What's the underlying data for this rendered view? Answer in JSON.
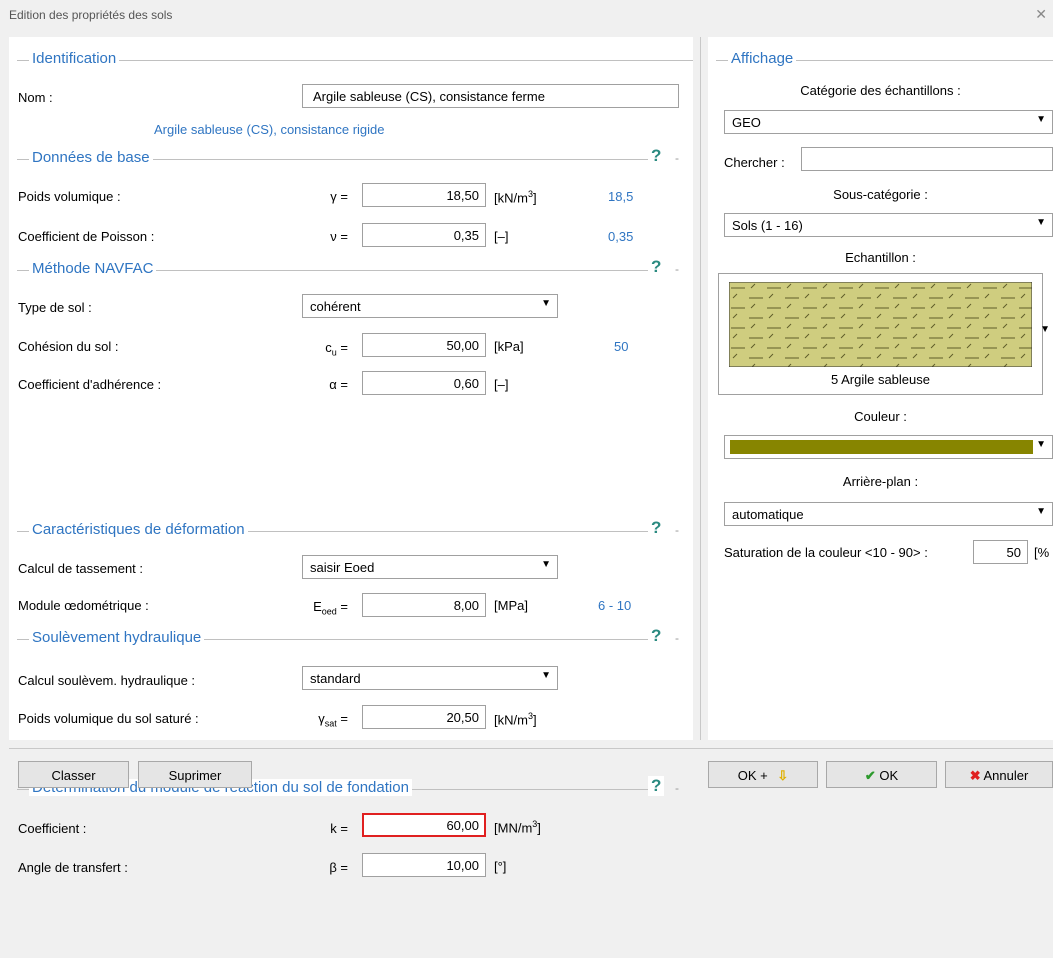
{
  "window": {
    "title": "Edition des propriétés des sols",
    "close_glyph": "✕"
  },
  "identification": {
    "section_label": "Identification",
    "name_label": "Nom :",
    "name_value": "Argile sableuse (CS), consistance ferme",
    "hint": "Argile sableuse (CS), consistance rigide"
  },
  "base": {
    "section_label": "Données de base",
    "help": "?",
    "unit_weight": {
      "label": "Poids volumique :",
      "symbol": "γ =",
      "value": "18,50",
      "unit_main": "[kN/m",
      "unit_sup": "3",
      "unit_end": "]",
      "hint": "18,5"
    },
    "poisson": {
      "label": "Coefficient de Poisson :",
      "symbol": "ν =",
      "value": "0,35",
      "unit": "[–]",
      "hint": "0,35"
    }
  },
  "navfac": {
    "section_label": "Méthode NAVFAC",
    "help": "?",
    "soil_type": {
      "label": "Type de sol :",
      "value": "cohérent"
    },
    "cohesion": {
      "label": "Cohésion du sol :",
      "symbol_main": "c",
      "symbol_sub": "u",
      "symbol_end": " =",
      "value": "50,00",
      "unit": "[kPa]",
      "hint": "50"
    },
    "adhesion": {
      "label": "Coefficient d'adhérence :",
      "symbol": "α =",
      "value": "0,60",
      "unit": "[–]"
    }
  },
  "deformation": {
    "section_label": "Caractéristiques de déformation",
    "help": "?",
    "settlement": {
      "label": "Calcul de tassement :",
      "value": "saisir Eoed"
    },
    "oedometric": {
      "label": "Module œdométrique :",
      "symbol_main": "E",
      "symbol_sub": "oed",
      "symbol_end": " =",
      "value": "8,00",
      "unit": "[MPa]",
      "hint": "6 - 10"
    }
  },
  "uplift": {
    "section_label": "Soulèvement hydraulique",
    "help": "?",
    "calc": {
      "label": "Calcul soulèvem. hydraulique :",
      "value": "standard"
    },
    "saturated": {
      "label": "Poids volumique du sol saturé :",
      "symbol_main": "γ",
      "symbol_sub": "sat",
      "symbol_end": " =",
      "value": "20,50",
      "unit_main": "[kN/m",
      "unit_sup": "3",
      "unit_end": "]"
    }
  },
  "subgrade": {
    "section_label": "Détermination du module de réaction du sol de fondation",
    "help": "?",
    "coefficient": {
      "label": "Coefficient :",
      "symbol": "k =",
      "value": "60,00",
      "unit_main": "[MN/m",
      "unit_sup": "3",
      "unit_end": "]"
    },
    "angle": {
      "label": "Angle de transfert :",
      "symbol": "β =",
      "value": "10,00",
      "unit": "[°]"
    }
  },
  "display": {
    "section_label": "Affichage",
    "category_label": "Catégorie des échantillons :",
    "category_value": "GEO",
    "search_label": "Chercher :",
    "search_value": "",
    "subcategory_label": "Sous-catégorie :",
    "subcategory_value": "Sols (1 - 16)",
    "sample_label": "Echantillon :",
    "sample_name": "5 Argile sableuse",
    "color_label": "Couleur :",
    "background_label": "Arrière-plan :",
    "background_value": "automatique",
    "saturation_label": "Saturation de la couleur <10 - 90> :",
    "saturation_value": "50",
    "saturation_unit": "[%",
    "colors": {
      "hatch_fill": "#cfcd7f",
      "hatch_line": "#5f5d2a",
      "color_swatch": "#878500"
    }
  },
  "footer": {
    "classify_label": "Classer",
    "delete_label": "Suprimer",
    "ok_plus_label": "OK +",
    "ok_label": "OK",
    "cancel_label": "Annuler"
  },
  "accent_colors": {
    "link_blue": "#2f75c2",
    "help_teal": "#2a8a80",
    "error_red": "#e02020"
  }
}
